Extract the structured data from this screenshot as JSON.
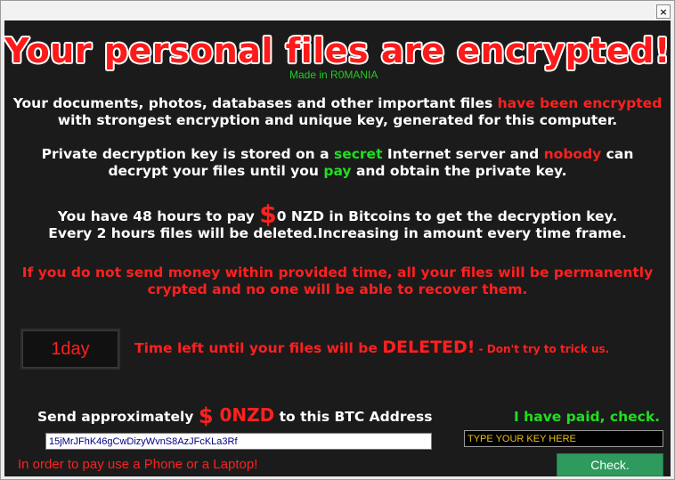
{
  "window": {
    "close_label": "×"
  },
  "header": {
    "title": "Your personal files are encrypted!",
    "made_in": "Made in R0MANIA"
  },
  "para1": {
    "line1_a": "Your documents, photos, databases and other important files ",
    "line1_b": "have been encrypted",
    "line2": "with strongest encryption and unique key, generated for this computer."
  },
  "para2": {
    "line1_a": "Private decryption key is stored on a ",
    "line1_b": "secret",
    "line1_c": " Internet server and ",
    "line1_d": "nobody",
    "line1_e": " can",
    "line2_a": "decrypt your files until you ",
    "line2_b": "pay",
    "line2_c": " and obtain the private key."
  },
  "para3": {
    "line1_a": "You have 48 hours to pay ",
    "dollar": "$",
    "line1_b": "0 NZD in Bitcoins to get the decryption key.",
    "line2": "Every 2 hours files will be deleted.Increasing in amount every time frame."
  },
  "warning": {
    "line1": "If you do not send money within provided time, all your files will be permanently",
    "line2": "crypted and no one will be able to recover them."
  },
  "timer": {
    "value": "1day",
    "label_a": "Time left until your files will be ",
    "label_b": "DELETED!",
    "label_c": " - Don't try to trick us."
  },
  "payment": {
    "send_a": "Send approximately ",
    "dollar": "$",
    "amount": " 0NZD",
    "send_b": " to this BTC Address",
    "btc_address": "15jMrJFhK46gCwDizyWvnS8AzJFcKLa3Rf",
    "paid_label": "I have paid, check.",
    "key_placeholder": "TYPE YOUR KEY HERE",
    "pay_hint": "In order to pay use a Phone or a Laptop!",
    "check_label": "Check."
  },
  "colors": {
    "background": "#1b1b1b",
    "accent_red": "#ff2020",
    "accent_green": "#22dd22",
    "key_text": "#e6c21a",
    "check_button": "#2e9a5e"
  }
}
